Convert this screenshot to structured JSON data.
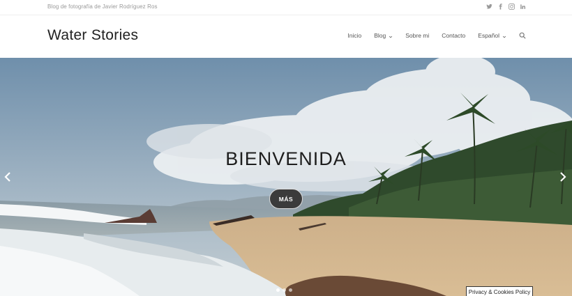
{
  "topbar": {
    "tagline": "Blog de fotografía de Javier Rodríguez Ros",
    "socials": [
      "twitter-icon",
      "facebook-icon",
      "instagram-icon",
      "linkedin-icon"
    ]
  },
  "header": {
    "logo": "Water Stories",
    "nav": {
      "home": "Inicio",
      "blog": "Blog",
      "about": "Sobre mi",
      "contact": "Contacto",
      "language": "Español"
    }
  },
  "hero": {
    "title": "BIENVENIDA",
    "button": "MÁS",
    "slides": 3,
    "active_slide": 1
  },
  "cookie": {
    "label": "Privacy & Cookies Policy"
  },
  "colors": {
    "sky": "#7b98b2",
    "sand": "#d3b58c",
    "button": "#3b3b3b"
  }
}
